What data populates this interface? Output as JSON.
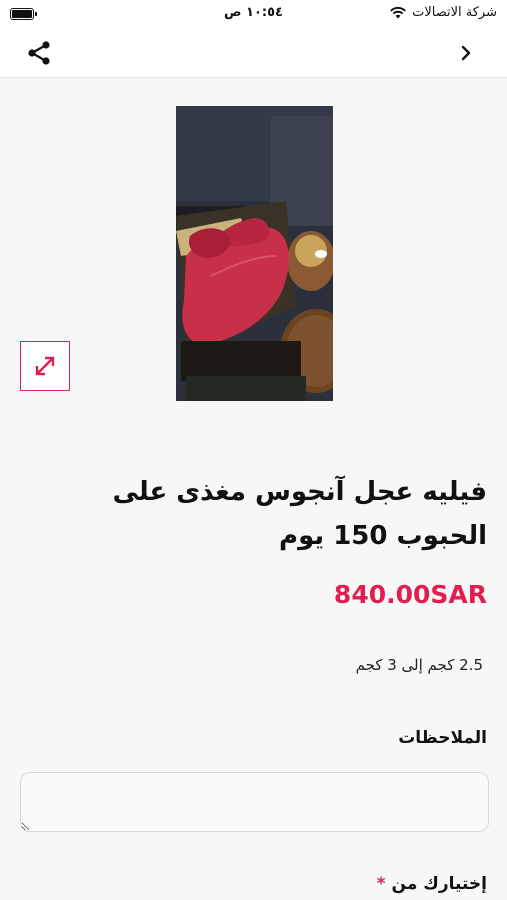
{
  "status_bar": {
    "carrier": "شركة الاتصالات",
    "time": "١٠:٥٤ ص"
  },
  "nav": {
    "share_icon": "share-icon",
    "back_icon": "chevron-right-icon"
  },
  "product": {
    "title": "فيليه عجل آنجوس مغذى على الحبوب 150 يوم",
    "price": "840.00SAR",
    "weight_range": "2.5 كجم إلى 3 كجم",
    "accent_color": "#e01e50"
  },
  "form": {
    "notes_label": "الملاحظات",
    "notes_value": "",
    "choose_label": "إختيارك من",
    "required_mark": "*"
  }
}
